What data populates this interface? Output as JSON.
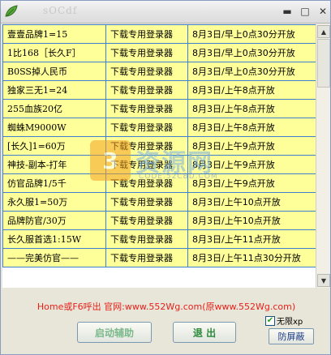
{
  "window": {
    "title": "sOCdf",
    "minimize_glyph": "▬",
    "maximize_glyph": "□",
    "close_glyph": "✕",
    "icon": "app-leaf-icon",
    "accent": "#3f7fd0",
    "row_bg": "#ffff99"
  },
  "servers": [
    {
      "name": "壹壹品牌1=15",
      "login": "下载专用登录器",
      "time": "8月3日/早上0点30分开放"
    },
    {
      "name": "1比168［长久F］",
      "login": "下载专用登录器",
      "time": "8月3日/早上0点30分开放"
    },
    {
      "name": "B0SS掉人民币",
      "login": "下载专用登录器",
      "time": "8月3日/早上0点30分开放"
    },
    {
      "name": "独家三无1=24",
      "login": "下载专用登录器",
      "time": "8月3日/上午8点开放"
    },
    {
      "name": "255血族20亿",
      "login": "下载专用登录器",
      "time": "8月3日/上午8点开放"
    },
    {
      "name": "蜘蛛M9000W",
      "login": "下载专用登录器",
      "time": "8月3日/上午8点开放"
    },
    {
      "name": "[长久]1=60万",
      "login": "下载专用登录器",
      "time": "8月3日/上午9点开放"
    },
    {
      "name": "神技-副本-打年",
      "login": "下载专用登录器",
      "time": "8月3日/上午9点开放"
    },
    {
      "name": "仿官品牌1/5千",
      "login": "下载专用登录器",
      "time": "8月3日/上午9点开放"
    },
    {
      "name": "永久服1=50万",
      "login": "下载专用登录器",
      "time": "8月3日/上午10点开放"
    },
    {
      "name": "品牌防官/30万",
      "login": "下载专用登录器",
      "time": "8月3日/上午10点开放"
    },
    {
      "name": "长久服首选1:15W",
      "login": "下载专用登录器",
      "time": "8月3日/上午11点开放"
    },
    {
      "name": "——完美仿官——",
      "login": "下载专用登录器",
      "time": "8月3日/上午11点30分开放"
    }
  ],
  "watermark": {
    "logo": "3",
    "text": "资源网",
    "sub": "CODE.52CBD.COM"
  },
  "notice": "Home或F6呼出 官网:www.552Wg.com(原www.552Wg.com)",
  "buttons": {
    "start": "启动辅助",
    "exit": "退 出",
    "shield": "防屏蔽"
  },
  "checkbox": {
    "label": "无限xp",
    "checked": true,
    "mark": "✔"
  }
}
